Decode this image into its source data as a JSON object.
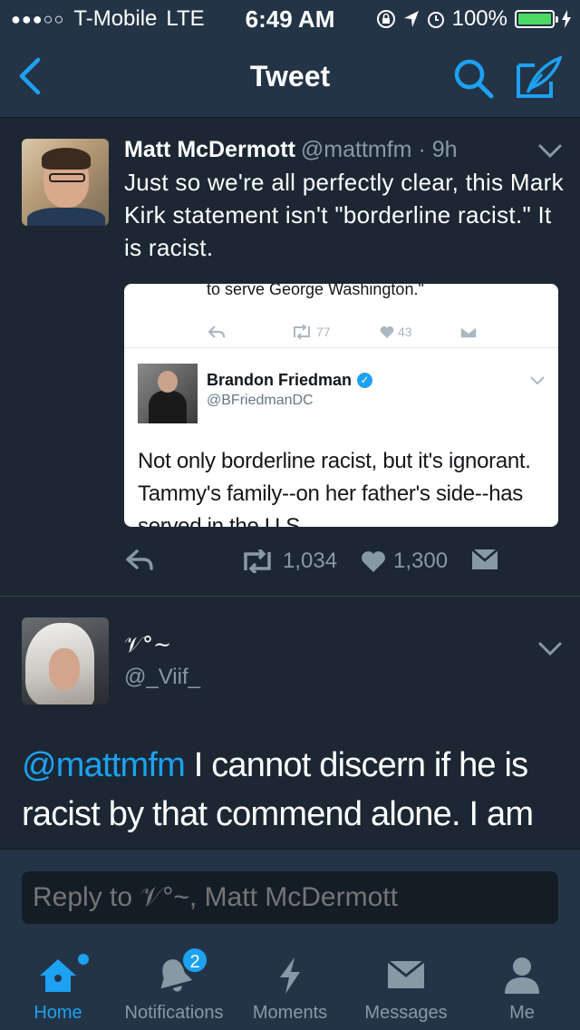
{
  "status_bar": {
    "carrier": "T-Mobile",
    "network": "LTE",
    "time": "6:49 AM",
    "battery": "100%",
    "battery_level": 1.0
  },
  "nav": {
    "title": "Tweet",
    "icons": [
      "back-icon",
      "search-icon",
      "compose-icon"
    ]
  },
  "tweet": {
    "name": "Matt McDermott",
    "handle": "@mattmfm · 9h",
    "text": "Just so we're all perfectly clear, this Mark Kirk statement isn't \"borderline racist.\" It is racist.",
    "retweets": "1,034",
    "likes": "1,300",
    "embedded": {
      "top_text": "to serve George Washington.\"",
      "retweets": "77",
      "likes": "43",
      "name": "Brandon Friedman",
      "handle": "@BFriedmanDC",
      "text": "Not only borderline racist, but it's ignorant. Tammy's family--on her father's side--has served in the U.S."
    }
  },
  "reply": {
    "name": "𝒱°~",
    "handle": "@_Viif_",
    "mention": "@mattmfm",
    "text": " I cannot discern if he  is racist by that commend alone. I am not saying he..."
  },
  "reply_bar": {
    "placeholder": "Reply to 𝒱°~, Matt McDermott"
  },
  "tabs": [
    {
      "label": "Home",
      "icon": "home-icon",
      "active": true
    },
    {
      "label": "Notifications",
      "icon": "bell-icon",
      "badge": "2"
    },
    {
      "label": "Moments",
      "icon": "lightning-icon"
    },
    {
      "label": "Messages",
      "icon": "envelope-icon"
    },
    {
      "label": "Me",
      "icon": "person-icon"
    }
  ],
  "colors": {
    "accent": "#1da1f2",
    "background": "#1c2733",
    "bar": "#243447",
    "secondary_text": "#8899a6"
  }
}
